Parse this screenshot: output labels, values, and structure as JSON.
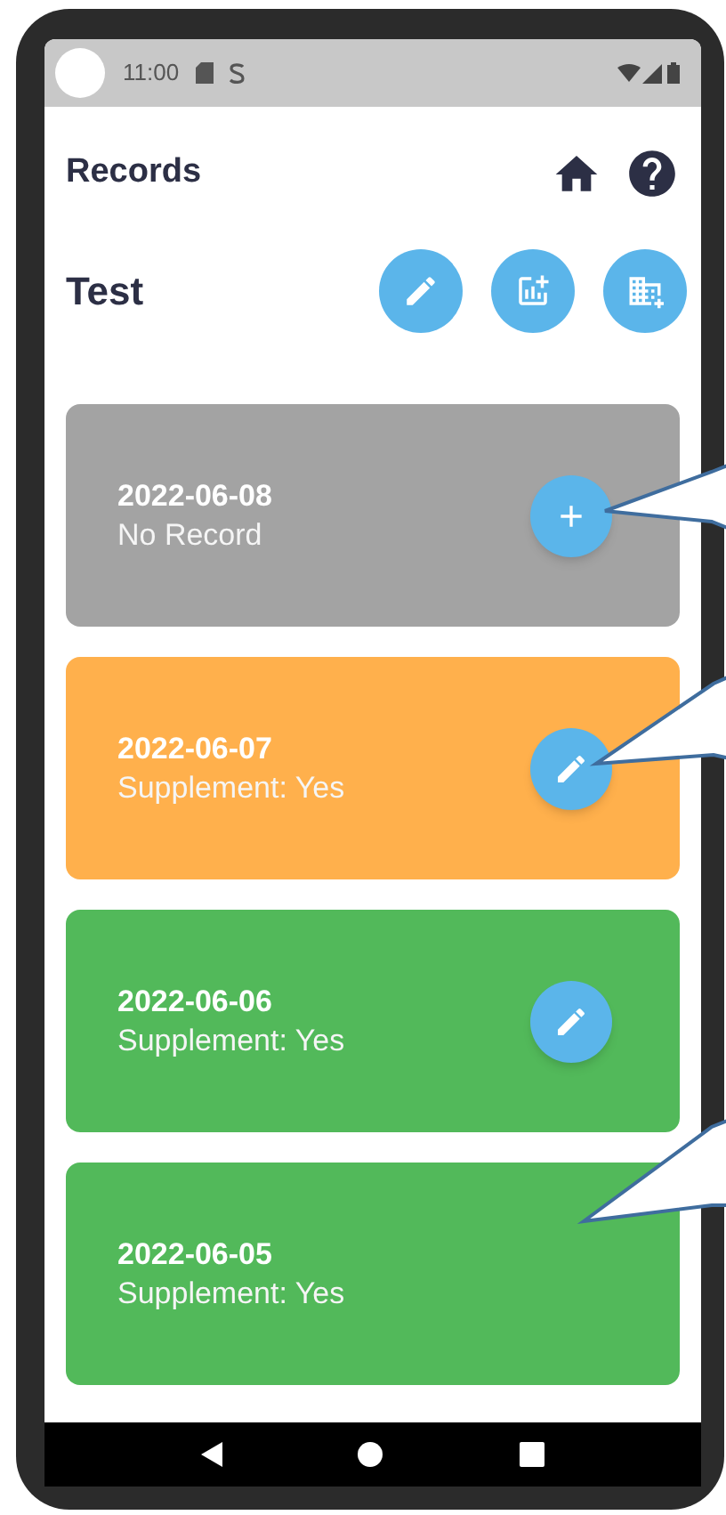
{
  "status_bar": {
    "time": "11:00"
  },
  "header": {
    "title": "Records",
    "subtitle": "Test"
  },
  "records": [
    {
      "date": "2022-06-08",
      "detail": "No Record",
      "color": "#a3a3a3",
      "kind": "add"
    },
    {
      "date": "2022-06-07",
      "detail": "Supplement: Yes",
      "color": "#ffb04c",
      "kind": "edit"
    },
    {
      "date": "2022-06-06",
      "detail": "Supplement: Yes",
      "color": "#52b95a",
      "kind": "edit"
    },
    {
      "date": "2022-06-05",
      "detail": "Supplement: Yes",
      "color": "#52b95a",
      "kind": "plain"
    }
  ]
}
